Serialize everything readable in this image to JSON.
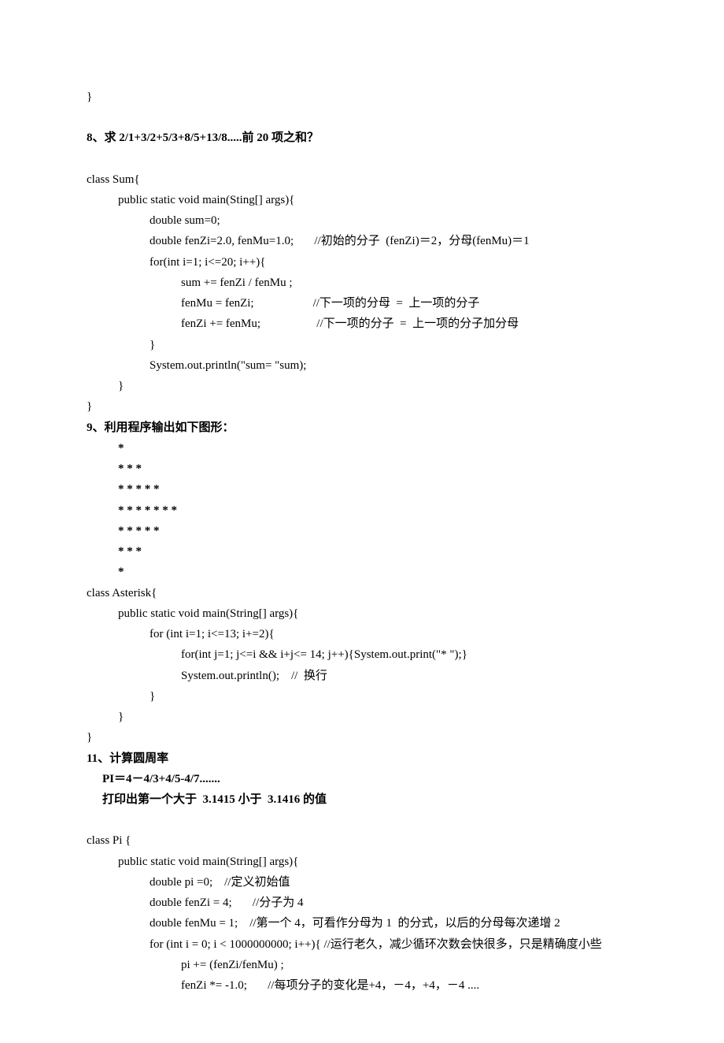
{
  "b0": {
    "l1": "}"
  },
  "title8": "8、求 2/1+3/2+5/3+8/5+13/8.....前 20 项之和？",
  "code8": {
    "l1": "class Sum{",
    "l2": "public static void main(Sting[] args){",
    "l3": "double sum=0;",
    "l4": "double fenZi=2.0, fenMu=1.0;       //初始的分子  (fenZi)＝2，分母(fenMu)＝1",
    "l5": "for(int i=1; i<=20; i++){",
    "l6": "sum += fenZi / fenMu ;",
    "l7": "fenMu = fenZi;                    //下一项的分母  =  上一项的分子",
    "l8": "fenZi += fenMu;                   //下一项的分子  =  上一项的分子加分母",
    "l9": "}",
    "l10": "System.out.println(\"sum= \"sum);",
    "l11": "}",
    "l12": "}"
  },
  "title9": "9、利用程序输出如下图形：",
  "ast": {
    "r1": "*",
    "r2": "* * *",
    "r3": "* * * * *",
    "r4": "* * * * * * *",
    "r5": "* * * * *",
    "r6": "* * *",
    "r7": "*"
  },
  "code9": {
    "l1": "class Asterisk{",
    "l2": "public static void main(String[] args){",
    "l3": "for (int i=1; i<=13; i+=2){",
    "l4": "for(int j=1; j<=i && i+j<= 14; j++){System.out.print(\"* \");}",
    "l5": "System.out.println();    //  换行",
    "l6": "}",
    "l7": "}",
    "l8": "}"
  },
  "title11": {
    "h": "11、计算圆周率",
    "s1": "PI＝4－4/3+4/5-4/7.......",
    "s2": "打印出第一个大于  3.1415 小于  3.1416 的值"
  },
  "code11": {
    "l1": "class Pi {",
    "l2": "public static void main(String[] args){",
    "l3": "double pi =0;    //定义初始值",
    "l4": "double fenZi = 4;       //分子为 4",
    "l5": "double fenMu = 1;    //第一个 4，可看作分母为 1  的分式，以后的分母每次递增 2",
    "l6": "for (int i = 0; i < 1000000000; i++){ //运行老久，减少循环次数会快很多，只是精确度小些",
    "l7": "pi += (fenZi/fenMu) ;",
    "l8": "fenZi *= -1.0;       //每项分子的变化是+4，－4，+4，－4 ...."
  }
}
